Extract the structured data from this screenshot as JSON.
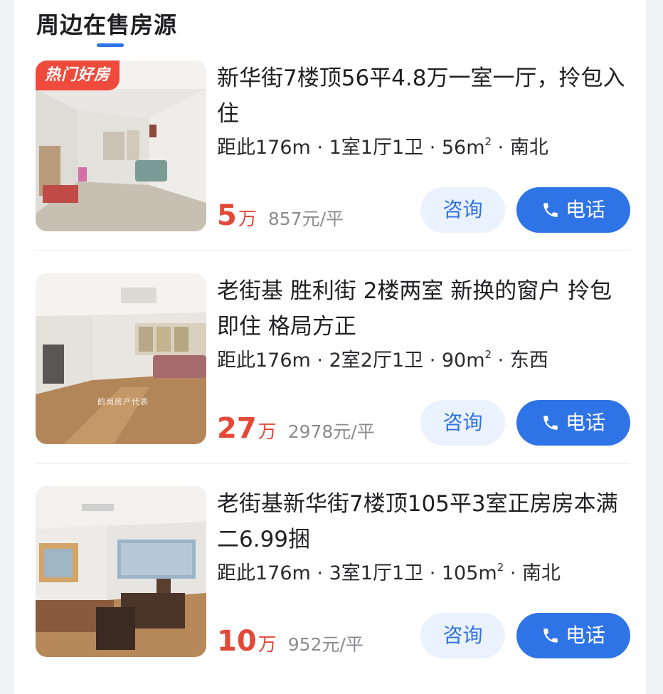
{
  "section": {
    "title": "周边在售房源"
  },
  "listings": [
    {
      "tag": "热门好房",
      "title": "新华街7楼顶56平4.8万一室一厅，拎包入住",
      "meta": "距此176m · 1室1厅1卫 · 56m² · 南北",
      "price": "5",
      "price_unit": "万",
      "unit_price": "857元/平",
      "consult_label": "咨询",
      "call_label": "电话"
    },
    {
      "watermark": "鹤岗房产代表",
      "title": "老街基 胜利街 2楼两室 新换的窗户 拎包即住 格局方正",
      "meta": "距此176m · 2室2厅1卫 · 90m² · 东西",
      "price": "27",
      "price_unit": "万",
      "unit_price": "2978元/平",
      "consult_label": "咨询",
      "call_label": "电话"
    },
    {
      "title": "老街基新华街7楼顶105平3室正房房本满二6.99捆",
      "meta": "距此176m · 3室1厅1卫 · 105m² · 南北",
      "price": "10",
      "price_unit": "万",
      "unit_price": "952元/平",
      "consult_label": "咨询",
      "call_label": "电话"
    }
  ],
  "colors": {
    "accent": "#2f74e6",
    "price_red": "#e24a37",
    "hot_tag": "#ef4b3c"
  },
  "icons": {
    "call": "phone-icon"
  }
}
